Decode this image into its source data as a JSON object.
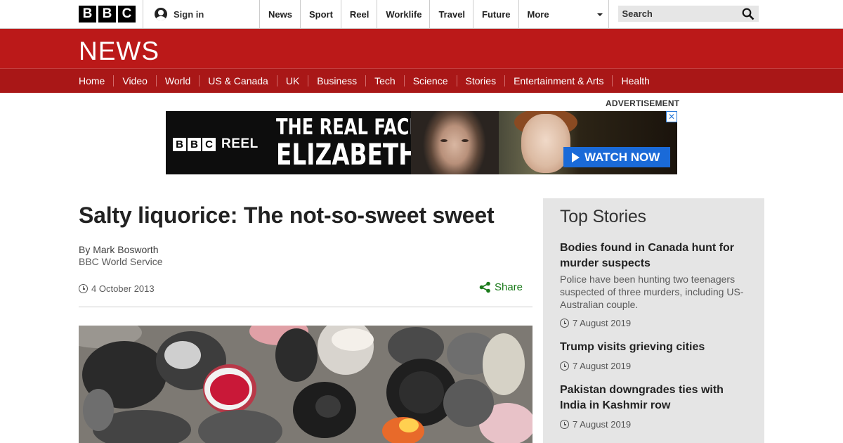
{
  "header": {
    "logo_letters": [
      "B",
      "B",
      "C"
    ],
    "signin_label": "Sign in",
    "nav": [
      "News",
      "Sport",
      "Reel",
      "Worklife",
      "Travel",
      "Future",
      "More"
    ],
    "search_placeholder": "Search"
  },
  "news_banner": {
    "wordmark": "NEWS",
    "sections": [
      "Home",
      "Video",
      "World",
      "US & Canada",
      "UK",
      "Business",
      "Tech",
      "Science",
      "Stories",
      "Entertainment & Arts",
      "Health"
    ]
  },
  "advertisement": {
    "label": "ADVERTISEMENT",
    "logo_letters": [
      "B",
      "B",
      "C"
    ],
    "logo_word": "REEL",
    "headline_line1": "THE REAL FACE OF",
    "headline_line2": "ELIZABETH I",
    "cta": "WATCH NOW",
    "close_glyph": "✕"
  },
  "article": {
    "title": "Salty liquorice: The not-so-sweet sweet",
    "author": "By Mark Bosworth",
    "organisation": "BBC World Service",
    "date": "4 October 2013",
    "share_label": "Share"
  },
  "top_stories": {
    "heading": "Top Stories",
    "items": [
      {
        "title": "Bodies found in Canada hunt for murder suspects",
        "summary": "Police have been hunting two teenagers suspected of three murders, including US-Australian couple.",
        "date": "7 August 2019"
      },
      {
        "title": "Trump visits grieving cities",
        "date": "7 August 2019"
      },
      {
        "title": "Pakistan downgrades ties with India in Kashmir row",
        "date": "7 August 2019"
      }
    ]
  },
  "colors": {
    "news_red": "#bb1919",
    "section_nav_red": "#a91717",
    "share_green": "#1a7a1a",
    "cta_blue": "#1a6ad8",
    "panel_grey": "#e5e5e5"
  },
  "icons": [
    "user-icon",
    "caret-down-icon",
    "search-icon",
    "close-icon",
    "play-icon",
    "clock-icon",
    "share-icon"
  ]
}
